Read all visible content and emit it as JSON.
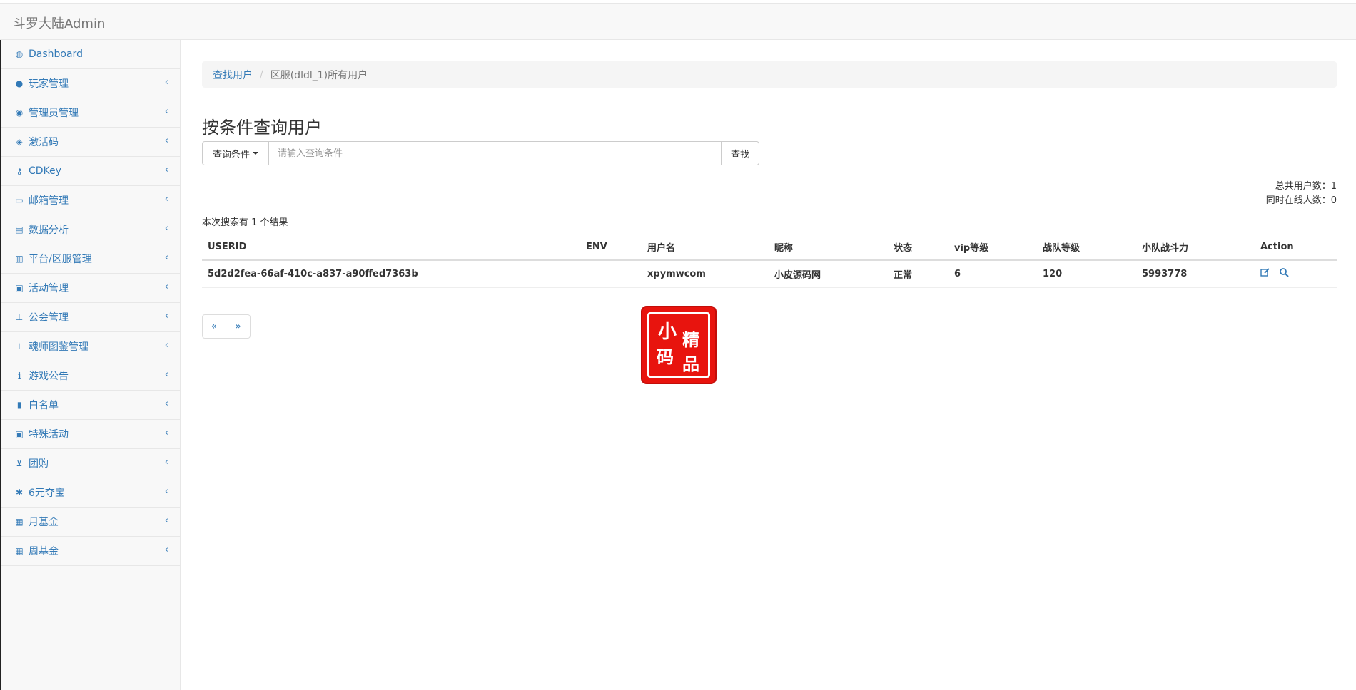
{
  "app": {
    "brand": "斗罗大陆Admin"
  },
  "sidebar": {
    "items": [
      {
        "label": "Dashboard",
        "icon": "dashboard-icon",
        "glyph": "◍",
        "has_arrow": false
      },
      {
        "label": "玩家管理",
        "icon": "user-icon",
        "glyph": "●",
        "has_arrow": true
      },
      {
        "label": "管理员管理",
        "icon": "users-icon",
        "glyph": "◉",
        "has_arrow": true
      },
      {
        "label": "激活码",
        "icon": "cube-icon",
        "glyph": "◈",
        "has_arrow": true
      },
      {
        "label": "CDKey",
        "icon": "key-icon",
        "glyph": "⚷",
        "has_arrow": true
      },
      {
        "label": "邮箱管理",
        "icon": "inbox-icon",
        "glyph": "▭",
        "has_arrow": true
      },
      {
        "label": "数据分析",
        "icon": "chart-icon",
        "glyph": "▤",
        "has_arrow": true
      },
      {
        "label": "平台/区服管理",
        "icon": "bank-icon",
        "glyph": "▥",
        "has_arrow": true
      },
      {
        "label": "活动管理",
        "icon": "gift-icon",
        "glyph": "▣",
        "has_arrow": true
      },
      {
        "label": "公会管理",
        "icon": "sitemap-icon",
        "glyph": "⊥",
        "has_arrow": true
      },
      {
        "label": "魂师图鉴管理",
        "icon": "sitemap-icon",
        "glyph": "⊥",
        "has_arrow": true
      },
      {
        "label": "游戏公告",
        "icon": "info-icon",
        "glyph": "ℹ",
        "has_arrow": true
      },
      {
        "label": "白名单",
        "icon": "file-icon",
        "glyph": "▮",
        "has_arrow": true
      },
      {
        "label": "特殊活动",
        "icon": "money-icon",
        "glyph": "▣",
        "has_arrow": true
      },
      {
        "label": "团购",
        "icon": "cart-icon",
        "glyph": "⊻",
        "has_arrow": true
      },
      {
        "label": "6元夺宝",
        "icon": "asterisk-icon",
        "glyph": "✱",
        "has_arrow": true
      },
      {
        "label": "月基金",
        "icon": "calendar-icon",
        "glyph": "▦",
        "has_arrow": true
      },
      {
        "label": "周基金",
        "icon": "calendar-icon",
        "glyph": "▦",
        "has_arrow": true
      }
    ],
    "arrow_glyph": "‹"
  },
  "breadcrumb": {
    "link": "查找用户",
    "separator": "/",
    "active": "区服(dldl_1)所有用户"
  },
  "page": {
    "title": "按条件查询用户"
  },
  "search": {
    "dropdown_label": "查询条件",
    "input_value": "",
    "placeholder": "请输入查询条件",
    "button_label": "查找"
  },
  "stats": {
    "total_label": "总共用户数：",
    "total_value": "1",
    "online_label": "同时在线人数：",
    "online_value": "0"
  },
  "results": {
    "note": "本次搜索有 1 个结果"
  },
  "table": {
    "columns": [
      "USERID",
      "ENV",
      "用户名",
      "昵称",
      "状态",
      "vip等级",
      "战队等级",
      "小队战斗力",
      "Action"
    ],
    "rows": [
      {
        "userid": "5d2d2fea-66af-410c-a837-a90ffed7363b",
        "env": "",
        "username": "xpymwcom",
        "nickname": "小皮源码网",
        "status": "正常",
        "vip": "6",
        "team_level": "120",
        "power": "5993778",
        "actions": [
          "edit-icon",
          "search-icon"
        ]
      }
    ]
  },
  "pagination": {
    "prev": "«",
    "next": "»"
  },
  "stamp": {
    "chars": [
      "小",
      "精",
      "码",
      "品"
    ],
    "color": "#e8140e"
  },
  "colors": {
    "link": "#337ab7",
    "sidebar_bg": "#f8f8f8"
  }
}
